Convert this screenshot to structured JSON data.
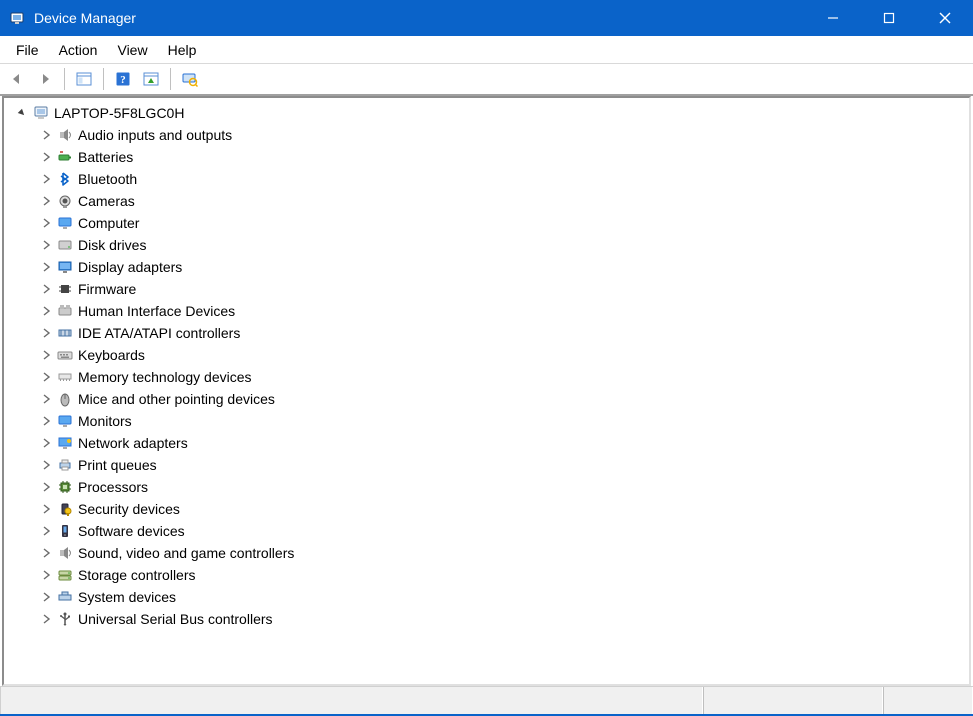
{
  "window": {
    "title": "Device Manager"
  },
  "menu": {
    "file": "File",
    "action": "Action",
    "view": "View",
    "help": "Help"
  },
  "tree": {
    "root": {
      "label": "LAPTOP-5F8LGC0H",
      "expanded": true
    },
    "categories": [
      {
        "label": "Audio inputs and outputs",
        "icon": "speaker"
      },
      {
        "label": "Batteries",
        "icon": "battery"
      },
      {
        "label": "Bluetooth",
        "icon": "bluetooth"
      },
      {
        "label": "Cameras",
        "icon": "camera"
      },
      {
        "label": "Computer",
        "icon": "monitor"
      },
      {
        "label": "Disk drives",
        "icon": "disk"
      },
      {
        "label": "Display adapters",
        "icon": "display"
      },
      {
        "label": "Firmware",
        "icon": "chip"
      },
      {
        "label": "Human Interface Devices",
        "icon": "hid"
      },
      {
        "label": "IDE ATA/ATAPI controllers",
        "icon": "ide"
      },
      {
        "label": "Keyboards",
        "icon": "keyboard"
      },
      {
        "label": "Memory technology devices",
        "icon": "memory"
      },
      {
        "label": "Mice and other pointing devices",
        "icon": "mouse"
      },
      {
        "label": "Monitors",
        "icon": "monitor"
      },
      {
        "label": "Network adapters",
        "icon": "network"
      },
      {
        "label": "Print queues",
        "icon": "printer"
      },
      {
        "label": "Processors",
        "icon": "cpu"
      },
      {
        "label": "Security devices",
        "icon": "security"
      },
      {
        "label": "Software devices",
        "icon": "software"
      },
      {
        "label": "Sound, video and game controllers",
        "icon": "speaker"
      },
      {
        "label": "Storage controllers",
        "icon": "storage"
      },
      {
        "label": "System devices",
        "icon": "system"
      },
      {
        "label": "Universal Serial Bus controllers",
        "icon": "usb"
      }
    ]
  }
}
